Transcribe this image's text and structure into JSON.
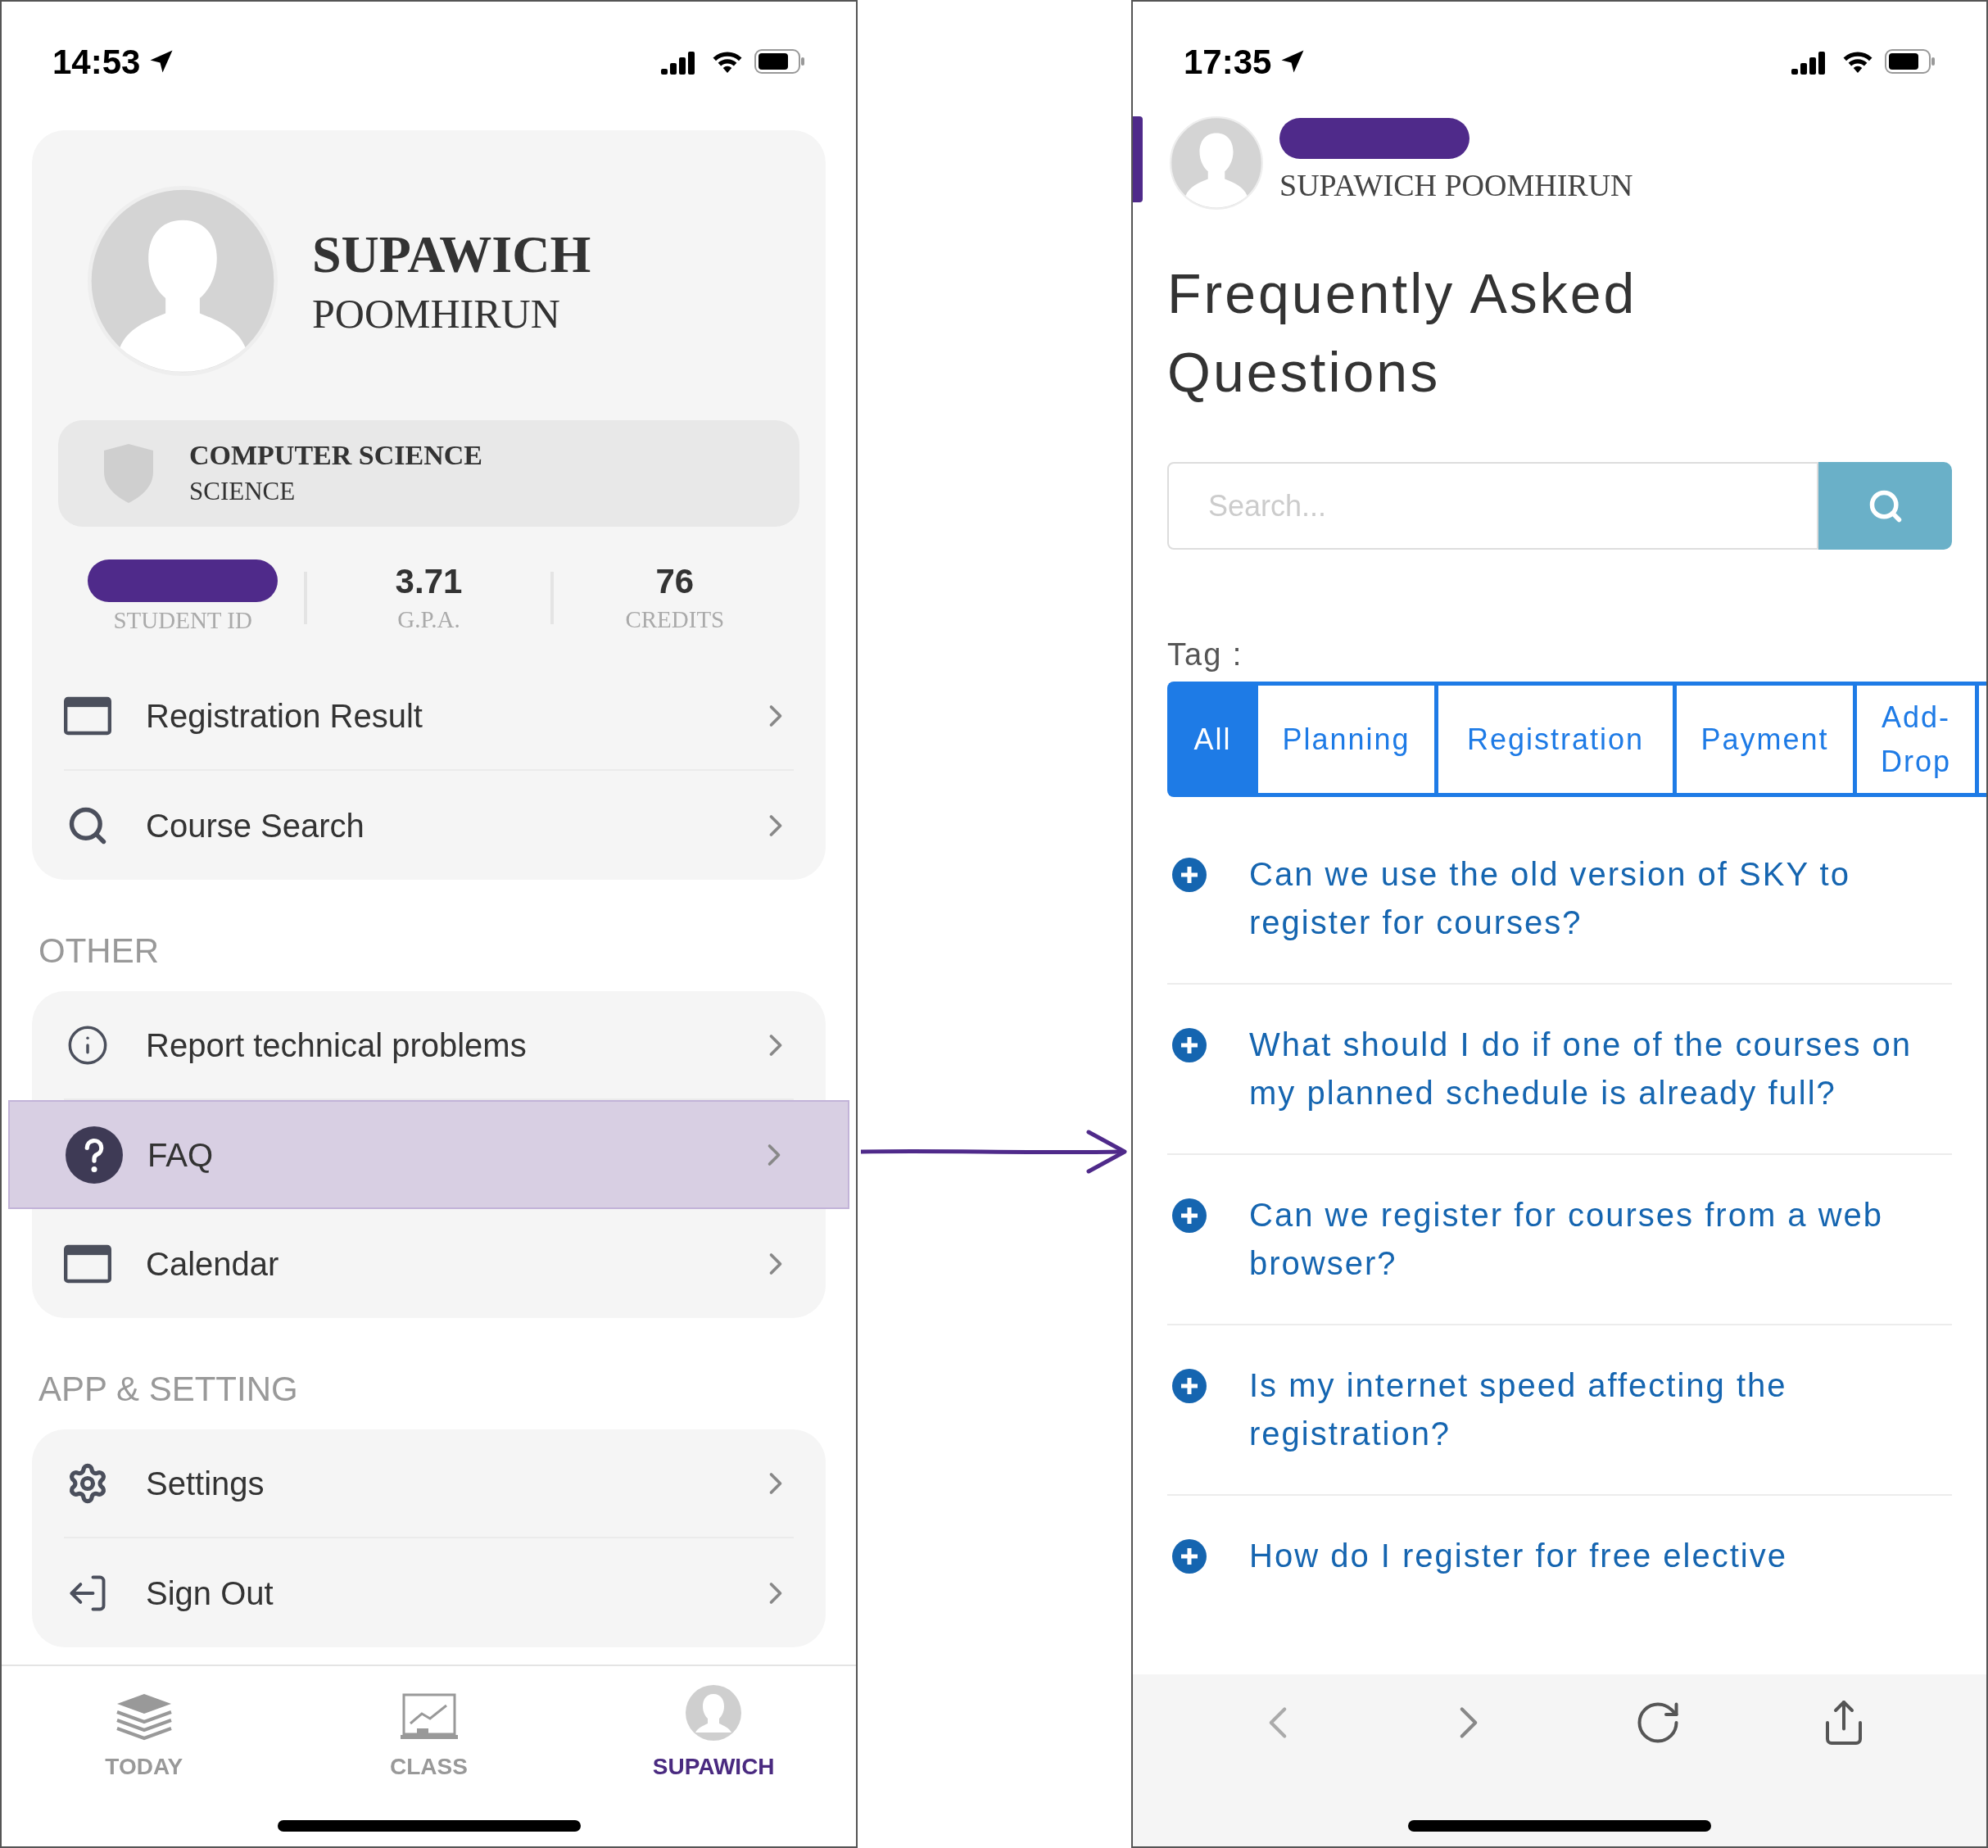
{
  "left_screen": {
    "status_bar": {
      "time": "14:53"
    },
    "profile": {
      "first_name": "SUPAWICH",
      "last_name": "POOMHIRUN",
      "program": "COMPUTER SCIENCE",
      "faculty": "SCIENCE",
      "stats": [
        {
          "kind": "redacted",
          "label": "STUDENT ID"
        },
        {
          "kind": "value",
          "value": "3.71",
          "label": "G.P.A."
        },
        {
          "kind": "value",
          "value": "76",
          "label": "CREDITS"
        }
      ]
    },
    "menu_groups": [
      {
        "items": [
          {
            "label": "Registration Result",
            "selected": false
          },
          {
            "label": "Course Search",
            "selected": false
          }
        ]
      },
      {
        "heading": "OTHER",
        "items": [
          {
            "label": "Report technical problems",
            "selected": false
          },
          {
            "label": "FAQ",
            "selected": true
          },
          {
            "label": "Calendar",
            "selected": false
          }
        ]
      },
      {
        "heading": "APP & SETTING",
        "items": [
          {
            "label": "Settings",
            "selected": false
          },
          {
            "label": "Sign Out",
            "selected": false
          }
        ]
      }
    ],
    "tab_bar": [
      {
        "label": "TODAY",
        "selected": false
      },
      {
        "label": "CLASS",
        "selected": false
      },
      {
        "label": "SUPAWICH",
        "selected": true
      }
    ]
  },
  "right_screen": {
    "status_bar": {
      "time": "17:35"
    },
    "user": {
      "name": "SUPAWICH POOMHIRUN"
    },
    "title": "Frequently Asked Questions",
    "search": {
      "placeholder": "Search..."
    },
    "tag_label": "Tag :",
    "tags": [
      {
        "label": "All",
        "selected": true
      },
      {
        "label": "Planning",
        "selected": false
      },
      {
        "label": "Registration",
        "selected": false
      },
      {
        "label": "Payment",
        "selected": false
      },
      {
        "label": "Add-Drop",
        "selected": false
      }
    ],
    "questions": [
      "Can we use the old version of SKY to register for courses?",
      "What should I do if one of the courses on my planned schedule is already full?",
      "Can we register for courses from a web browser?",
      "Is my internet speed affecting the registration?",
      "How do I register for free elective"
    ]
  }
}
